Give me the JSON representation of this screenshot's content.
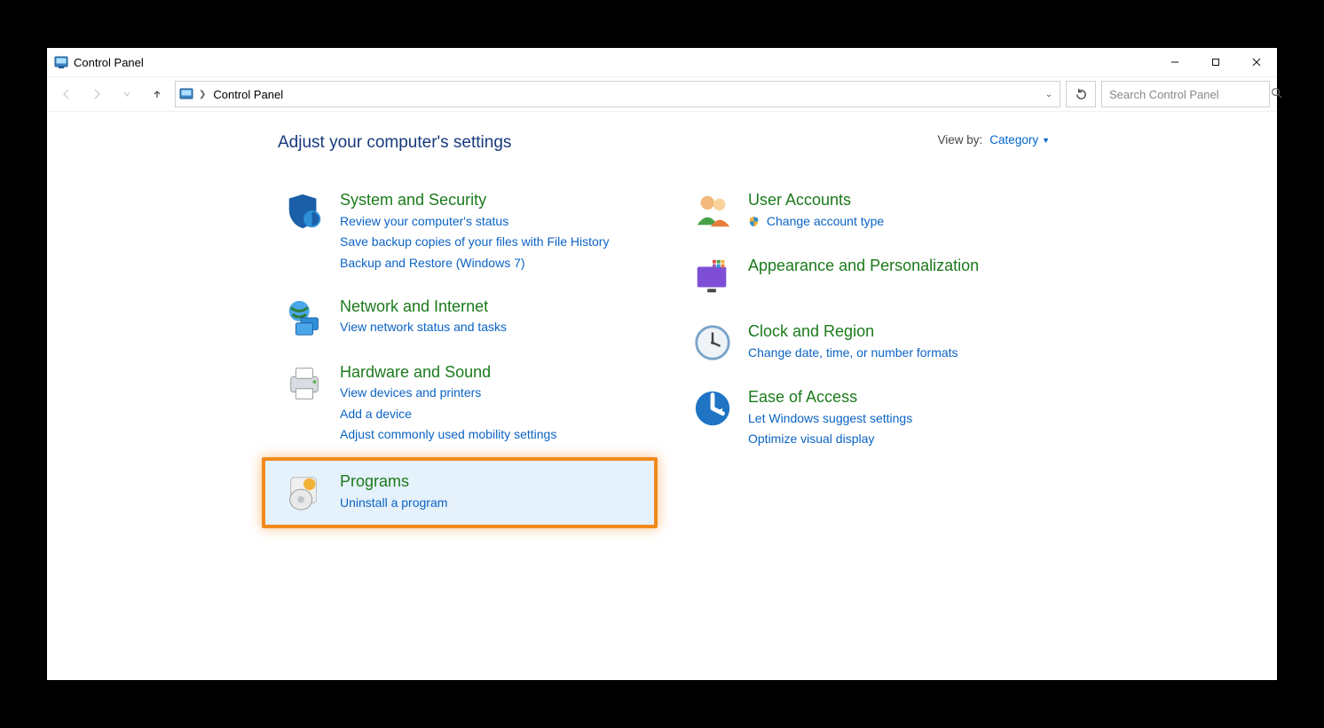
{
  "window": {
    "title": "Control Panel"
  },
  "toolbar": {
    "breadcrumb": "Control Panel",
    "search_placeholder": "Search Control Panel"
  },
  "header": {
    "title": "Adjust your computer's settings",
    "viewby_label": "View by:",
    "viewby_value": "Category"
  },
  "left": {
    "system": {
      "title": "System and Security",
      "links": [
        "Review your computer's status",
        "Save backup copies of your files with File History",
        "Backup and Restore (Windows 7)"
      ]
    },
    "network": {
      "title": "Network and Internet",
      "links": [
        "View network status and tasks"
      ]
    },
    "hardware": {
      "title": "Hardware and Sound",
      "links": [
        "View devices and printers",
        "Add a device",
        "Adjust commonly used mobility settings"
      ]
    },
    "programs": {
      "title": "Programs",
      "links": [
        "Uninstall a program"
      ]
    }
  },
  "right": {
    "users": {
      "title": "User Accounts",
      "links": [
        "Change account type"
      ]
    },
    "appearance": {
      "title": "Appearance and Personalization",
      "links": []
    },
    "clock": {
      "title": "Clock and Region",
      "links": [
        "Change date, time, or number formats"
      ]
    },
    "ease": {
      "title": "Ease of Access",
      "links": [
        "Let Windows suggest settings",
        "Optimize visual display"
      ]
    }
  }
}
